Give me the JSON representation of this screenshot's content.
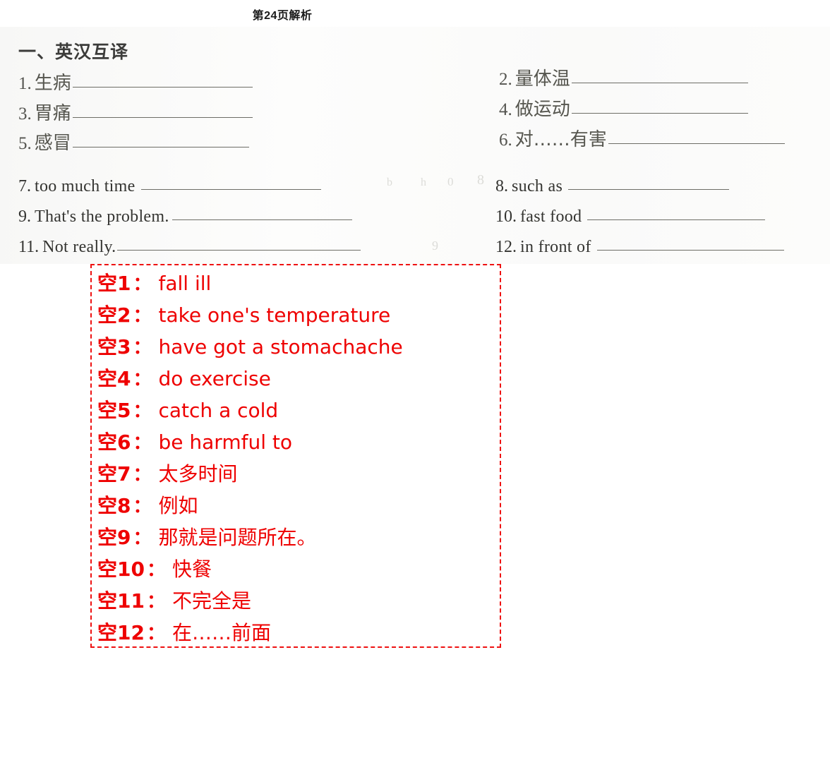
{
  "page": {
    "title": "第24页解析",
    "accent_color": "#ee0000",
    "scan_background": "#fbfbfa"
  },
  "worksheet": {
    "section_heading": "一、英汉互译",
    "chinese_items": [
      {
        "num": "1.",
        "word": "生病",
        "blank_width": 255
      },
      {
        "num": "2.",
        "word": "量体温",
        "blank_width": 250
      },
      {
        "num": "3.",
        "word": "胃痛",
        "blank_width": 255
      },
      {
        "num": "4.",
        "word": "做运动",
        "blank_width": 250
      },
      {
        "num": "5.",
        "word": "感冒",
        "blank_width": 250
      },
      {
        "num": "6.",
        "word": "对……有害",
        "blank_width": 250
      }
    ],
    "english_items": [
      {
        "num": "7.",
        "word": "too much time",
        "blank_width": 255
      },
      {
        "num": "8.",
        "word": "such as",
        "blank_width": 228
      },
      {
        "num": "9.",
        "word": "That's the problem.",
        "blank_width": 255
      },
      {
        "num": "10.",
        "word": "fast food",
        "blank_width": 252
      },
      {
        "num": "11.",
        "word": "Not really.",
        "blank_width": 345
      },
      {
        "num": "12.",
        "word": "in front of",
        "blank_width": 265
      }
    ],
    "ghost_marks": [
      "8",
      "9",
      "0",
      "b",
      "h"
    ]
  },
  "answers": {
    "items": [
      {
        "label": "空1",
        "colon": "：",
        "text": "fall ill"
      },
      {
        "label": "空2",
        "colon": "：",
        "text": "take one's temperature"
      },
      {
        "label": "空3",
        "colon": "：",
        "text": "have got a stomachache"
      },
      {
        "label": "空4",
        "colon": "：",
        "text": "do exercise"
      },
      {
        "label": "空5",
        "colon": "：",
        "text": "catch a cold"
      },
      {
        "label": "空6",
        "colon": "：",
        "text": "be harmful to"
      },
      {
        "label": "空7",
        "colon": "：",
        "text": "太多时间"
      },
      {
        "label": "空8",
        "colon": "：",
        "text": "例如"
      },
      {
        "label": "空9",
        "colon": "：",
        "text": "那就是问题所在。"
      },
      {
        "label": "空10",
        "colon": "：",
        "text": "快餐"
      },
      {
        "label": "空11",
        "colon": "：",
        "text": "不完全是"
      },
      {
        "label": "空12",
        "colon": "：",
        "text": "在……前面"
      }
    ]
  }
}
